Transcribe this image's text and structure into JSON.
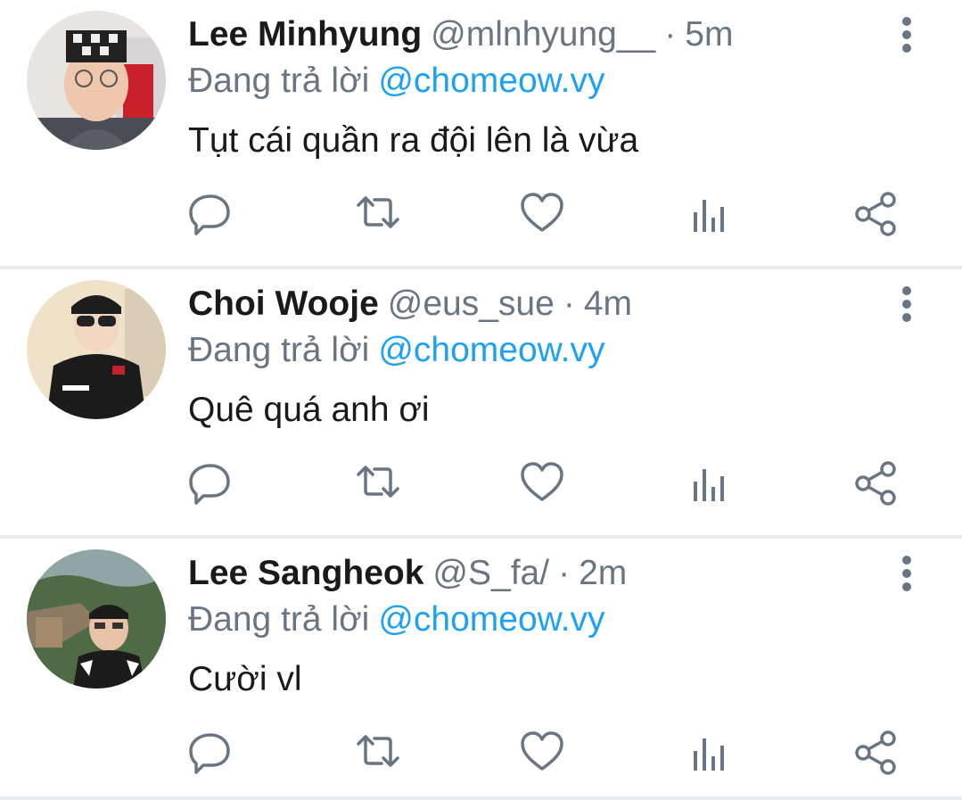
{
  "tweets": [
    {
      "name": "Lee Minhyung",
      "handle": "@mlnhyung__",
      "time": "5m",
      "reply_prefix": "Đang trả lời",
      "reply_to": "@chomeow.vy",
      "text": "Tụt cái quần ra đội lên là vừa"
    },
    {
      "name": "Choi Wooje",
      "handle": "@eus_sue",
      "time": "4m",
      "reply_prefix": "Đang trả lời",
      "reply_to": "@chomeow.vy",
      "text": "Quê quá anh ơi"
    },
    {
      "name": "Lee Sangheok",
      "handle": "@S_fa/",
      "time": "2m",
      "reply_prefix": "Đang trả lời",
      "reply_to": "@chomeow.vy",
      "text": "Cười vl"
    }
  ],
  "separator": "·",
  "colors": {
    "icon": "#687684",
    "mention": "#1da1f2",
    "text": "#1a1a1a",
    "divider": "#e6ecf0"
  },
  "icons": [
    "more-vertical-icon",
    "reply-icon",
    "retweet-icon",
    "like-icon",
    "analytics-icon",
    "share-icon"
  ]
}
